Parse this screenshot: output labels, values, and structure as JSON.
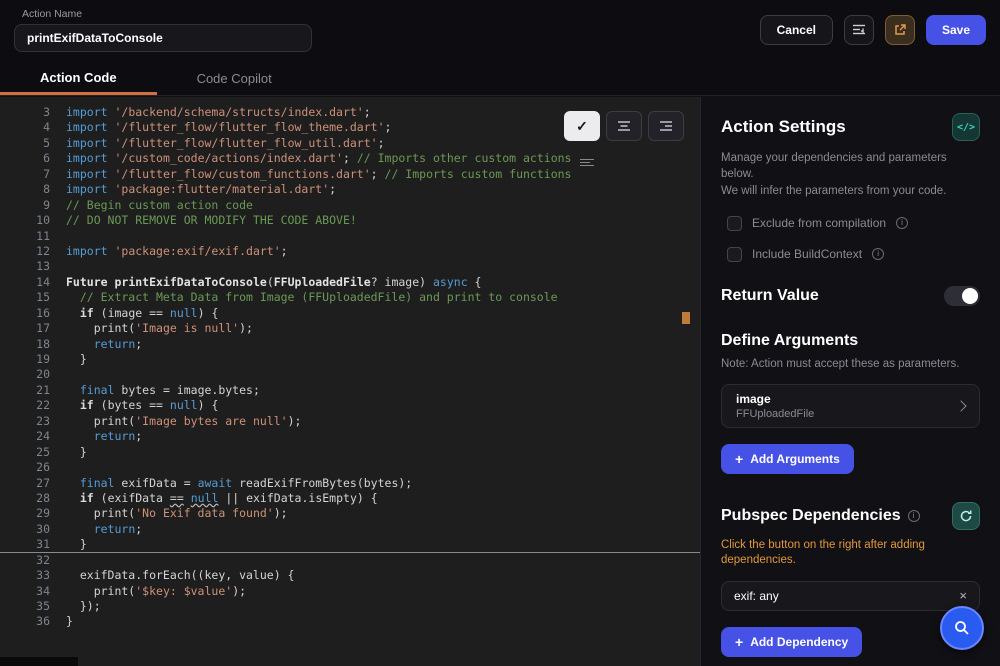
{
  "header": {
    "action_name_label": "Action Name",
    "action_name_value": "printExifDataToConsole",
    "cancel_label": "Cancel",
    "save_label": "Save"
  },
  "tabs": {
    "action_code": "Action Code",
    "code_copilot": "Code Copilot"
  },
  "editor": {
    "lines": [
      {
        "n": 3,
        "t": [
          [
            "kw",
            "import"
          ],
          [
            "pln",
            " "
          ],
          [
            "str",
            "'/backend/schema/structs/index.dart'"
          ],
          [
            "pln",
            ";"
          ]
        ]
      },
      {
        "n": 4,
        "t": [
          [
            "kw",
            "import"
          ],
          [
            "pln",
            " "
          ],
          [
            "str",
            "'/flutter_flow/flutter_flow_theme.dart'"
          ],
          [
            "pln",
            ";"
          ]
        ]
      },
      {
        "n": 5,
        "t": [
          [
            "kw",
            "import"
          ],
          [
            "pln",
            " "
          ],
          [
            "str",
            "'/flutter_flow/flutter_flow_util.dart'"
          ],
          [
            "pln",
            ";"
          ]
        ]
      },
      {
        "n": 6,
        "t": [
          [
            "kw",
            "import"
          ],
          [
            "pln",
            " "
          ],
          [
            "str",
            "'/custom_code/actions/index.dart'"
          ],
          [
            "pln",
            "; "
          ],
          [
            "com",
            "// Imports other custom actions"
          ]
        ]
      },
      {
        "n": 7,
        "t": [
          [
            "kw",
            "import"
          ],
          [
            "pln",
            " "
          ],
          [
            "str",
            "'/flutter_flow/custom_functions.dart'"
          ],
          [
            "pln",
            "; "
          ],
          [
            "com",
            "// Imports custom functions"
          ]
        ]
      },
      {
        "n": 8,
        "t": [
          [
            "kw",
            "import"
          ],
          [
            "pln",
            " "
          ],
          [
            "str",
            "'package:flutter/material.dart'"
          ],
          [
            "pln",
            ";"
          ]
        ]
      },
      {
        "n": 9,
        "t": [
          [
            "com",
            "// Begin custom action code"
          ]
        ]
      },
      {
        "n": 10,
        "t": [
          [
            "com",
            "// DO NOT REMOVE OR MODIFY THE CODE ABOVE!"
          ]
        ]
      },
      {
        "n": 11,
        "t": []
      },
      {
        "n": 12,
        "t": [
          [
            "kw",
            "import"
          ],
          [
            "pln",
            " "
          ],
          [
            "str",
            "'package:exif/exif.dart'"
          ],
          [
            "pln",
            ";"
          ]
        ]
      },
      {
        "n": 13,
        "t": []
      },
      {
        "n": 14,
        "t": [
          [
            "typ",
            "Future"
          ],
          [
            "pln",
            " "
          ],
          [
            "fn",
            "printExifDataToConsole"
          ],
          [
            "pln",
            "("
          ],
          [
            "typ",
            "FFUploadedFile"
          ],
          [
            "pln",
            "? image) "
          ],
          [
            "kw",
            "async"
          ],
          [
            "pln",
            " {"
          ]
        ]
      },
      {
        "n": 15,
        "t": [
          [
            "com",
            "  // Extract Meta Data from Image (FFUploadedFile) and print to console"
          ]
        ]
      },
      {
        "n": 16,
        "t": [
          [
            "pln",
            "  "
          ],
          [
            "kwb",
            "if"
          ],
          [
            "pln",
            " (image == "
          ],
          [
            "kw",
            "null"
          ],
          [
            "pln",
            ") {"
          ]
        ]
      },
      {
        "n": 17,
        "t": [
          [
            "pln",
            "    print("
          ],
          [
            "str",
            "'Image is null'"
          ],
          [
            "pln",
            ");"
          ]
        ]
      },
      {
        "n": 18,
        "t": [
          [
            "pln",
            "    "
          ],
          [
            "kw",
            "return"
          ],
          [
            "pln",
            ";"
          ]
        ]
      },
      {
        "n": 19,
        "t": [
          [
            "pln",
            "  }"
          ]
        ]
      },
      {
        "n": 20,
        "t": []
      },
      {
        "n": 21,
        "t": [
          [
            "pln",
            "  "
          ],
          [
            "kw",
            "final"
          ],
          [
            "pln",
            " bytes = image.bytes;"
          ]
        ]
      },
      {
        "n": 22,
        "t": [
          [
            "pln",
            "  "
          ],
          [
            "kwb",
            "if"
          ],
          [
            "pln",
            " (bytes == "
          ],
          [
            "kw",
            "null"
          ],
          [
            "pln",
            ") {"
          ]
        ]
      },
      {
        "n": 23,
        "t": [
          [
            "pln",
            "    print("
          ],
          [
            "str",
            "'Image bytes are null'"
          ],
          [
            "pln",
            ");"
          ]
        ]
      },
      {
        "n": 24,
        "t": [
          [
            "pln",
            "    "
          ],
          [
            "kw",
            "return"
          ],
          [
            "pln",
            ";"
          ]
        ]
      },
      {
        "n": 25,
        "t": [
          [
            "pln",
            "  }"
          ]
        ]
      },
      {
        "n": 26,
        "t": []
      },
      {
        "n": 27,
        "t": [
          [
            "pln",
            "  "
          ],
          [
            "kw",
            "final"
          ],
          [
            "pln",
            " exifData = "
          ],
          [
            "kw",
            "await"
          ],
          [
            "pln",
            " readExifFromBytes(bytes);"
          ]
        ]
      },
      {
        "n": 28,
        "t": [
          [
            "pln",
            "  "
          ],
          [
            "kwb",
            "if"
          ],
          [
            "pln",
            " (exifData "
          ],
          [
            "opw",
            "=="
          ],
          [
            "pln",
            " "
          ],
          [
            "kww",
            "null"
          ],
          [
            "pln",
            " || exifData.isEmpty) {"
          ]
        ]
      },
      {
        "n": 29,
        "t": [
          [
            "pln",
            "    print("
          ],
          [
            "str",
            "'No Exif data found'"
          ],
          [
            "pln",
            ");"
          ]
        ]
      },
      {
        "n": 30,
        "t": [
          [
            "pln",
            "    "
          ],
          [
            "kw",
            "return"
          ],
          [
            "pln",
            ";"
          ]
        ]
      },
      {
        "n": 31,
        "t": [
          [
            "pln",
            "  }"
          ]
        ],
        "active": true
      },
      {
        "n": 32,
        "t": []
      },
      {
        "n": 33,
        "t": [
          [
            "pln",
            "  exifData.forEach((key, value) {"
          ]
        ]
      },
      {
        "n": 34,
        "t": [
          [
            "pln",
            "    print("
          ],
          [
            "str",
            "'$key: $value'"
          ],
          [
            "pln",
            ");"
          ]
        ]
      },
      {
        "n": 35,
        "t": [
          [
            "pln",
            "  });"
          ]
        ]
      },
      {
        "n": 36,
        "t": [
          [
            "pln",
            "}"
          ]
        ]
      }
    ]
  },
  "panel": {
    "title": "Action Settings",
    "description1": "Manage your dependencies and parameters below.",
    "description2": "We will infer the parameters from your code.",
    "checkboxes": [
      "Exclude from compilation",
      "Include BuildContext"
    ],
    "return_value_label": "Return Value",
    "define_arguments_title": "Define Arguments",
    "define_arguments_note": "Note: Action must accept these as parameters.",
    "argument": {
      "name": "image",
      "type": "FFUploadedFile"
    },
    "add_arguments_label": "Add Arguments",
    "pubspec_title": "Pubspec Dependencies",
    "pubspec_warning": "Click the button on the right after adding dependencies.",
    "dependency_value": "exif: any",
    "add_dependency_label": "Add Dependency"
  },
  "colors": {
    "accent_blue": "#4651e5",
    "accent_teal": "#39d2c0",
    "accent_orange": "#cf7240",
    "warning_orange": "#e0983c",
    "editor_bg": "#1e1e1e"
  }
}
